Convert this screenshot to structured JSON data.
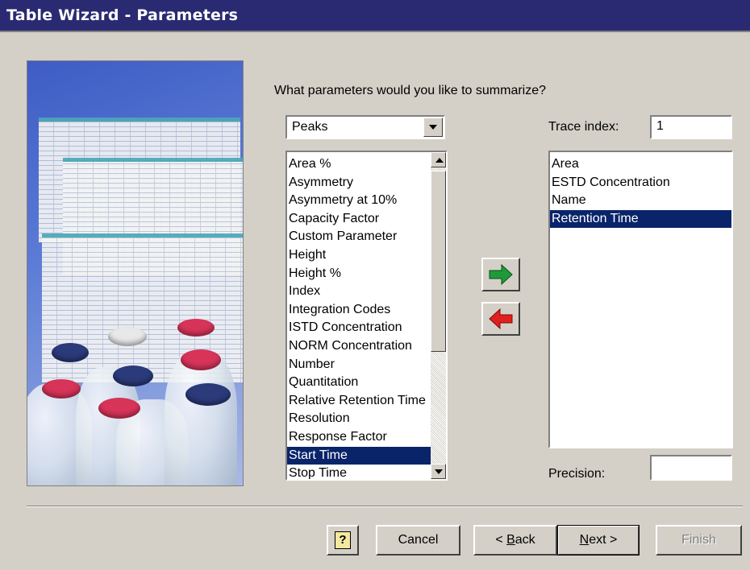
{
  "window": {
    "title": "Table Wizard - Parameters"
  },
  "prompt": "What parameters would you like to summarize?",
  "category_select": {
    "value": "Peaks"
  },
  "available_list": {
    "items": [
      "Area %",
      "Asymmetry",
      "Asymmetry at 10%",
      "Capacity Factor",
      "Custom Parameter",
      "Height",
      "Height %",
      "Index",
      "Integration Codes",
      "ISTD Concentration",
      "NORM Concentration",
      "Number",
      "Quantitation",
      "Relative Retention Time",
      "Resolution",
      "Response Factor",
      "Start Time",
      "Stop Time"
    ],
    "selected_index": 16
  },
  "trace_index": {
    "label": "Trace index:",
    "value": "1"
  },
  "selected_list": {
    "items": [
      "Area",
      "ESTD Concentration",
      "Name",
      "Retention Time"
    ],
    "selected_index": 3
  },
  "precision": {
    "label": "Precision:",
    "value": ""
  },
  "buttons": {
    "help": "?",
    "cancel": "Cancel",
    "back_prefix": "< ",
    "back_key": "B",
    "back_rest": "ack",
    "next_key": "N",
    "next_rest": "ext >",
    "finish": "Finish"
  },
  "icons": {
    "add_arrow": "green-right-arrow-icon",
    "remove_arrow": "red-left-arrow-icon",
    "help": "help-icon"
  },
  "colors": {
    "titlebar": "#2a2a72",
    "selection": "#0a246a",
    "add_arrow": "#1f9a3a",
    "remove_arrow": "#e0201e"
  }
}
